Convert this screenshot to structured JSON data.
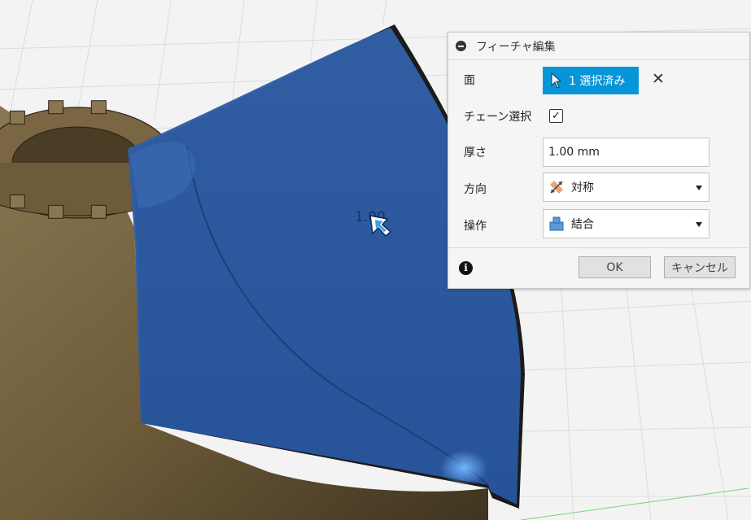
{
  "dialog": {
    "title": "フィーチャ編集",
    "rows": {
      "face": {
        "label": "面",
        "button_label": "1 選択済み"
      },
      "chain": {
        "label": "チェーン選択",
        "checked": true,
        "check_glyph": "✓"
      },
      "thickness": {
        "label": "厚さ",
        "value": "1.00 mm"
      },
      "direction": {
        "label": "方向",
        "selected": "対称"
      },
      "operation": {
        "label": "操作",
        "selected": "結合"
      }
    },
    "footer": {
      "info_glyph": "i",
      "ok": "OK",
      "cancel": "キャンセル"
    }
  },
  "viewport": {
    "dimension_label": "1.00",
    "colors": {
      "face_selection": "#2e5ba3",
      "body": "#7d6a45",
      "accent": "#0696d7"
    }
  }
}
